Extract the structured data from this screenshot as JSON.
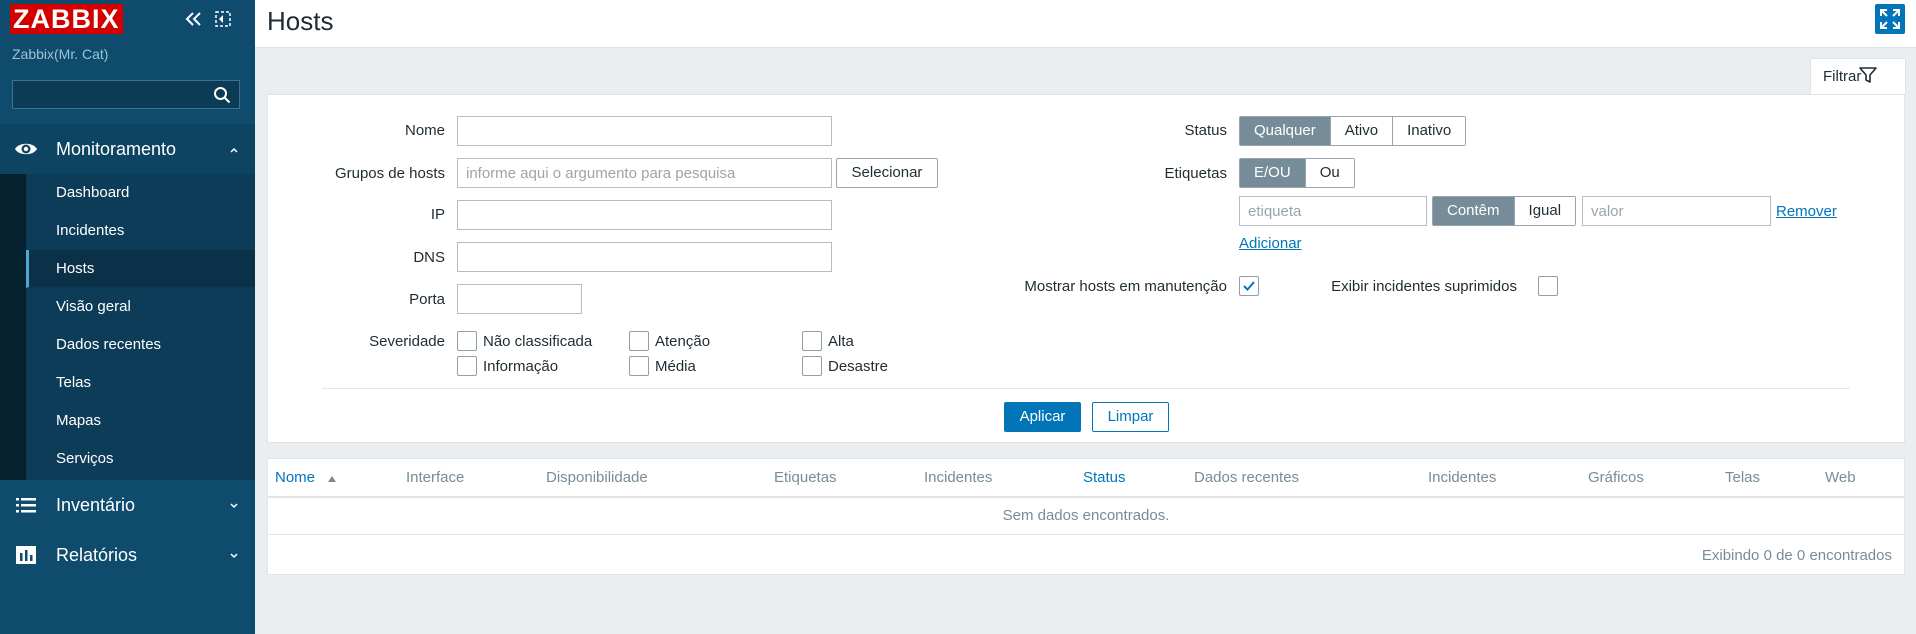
{
  "brand": {
    "logo": "ZABBIX",
    "server_name": "Zabbix(Mr. Cat)"
  },
  "sidebar": {
    "search_placeholder": "",
    "sections": [
      {
        "label": "Monitoramento",
        "icon": "eye-icon",
        "expanded": true
      },
      {
        "label": "Inventário",
        "icon": "list-icon",
        "expanded": false
      },
      {
        "label": "Relatórios",
        "icon": "bar-chart-icon",
        "expanded": false
      }
    ],
    "monitoring_items": [
      {
        "label": "Dashboard"
      },
      {
        "label": "Incidentes"
      },
      {
        "label": "Hosts",
        "active": true
      },
      {
        "label": "Visão geral"
      },
      {
        "label": "Dados recentes"
      },
      {
        "label": "Telas"
      },
      {
        "label": "Mapas"
      },
      {
        "label": "Serviços"
      }
    ]
  },
  "header": {
    "title": "Hosts"
  },
  "filter": {
    "tab_label": "Filtrar",
    "name_label": "Nome",
    "name_value": "",
    "host_groups_label": "Grupos de hosts",
    "host_groups_placeholder": "informe aqui o argumento para pesquisa",
    "select_button": "Selecionar",
    "ip_label": "IP",
    "ip_value": "",
    "dns_label": "DNS",
    "dns_value": "",
    "port_label": "Porta",
    "port_value": "",
    "severity_label": "Severidade",
    "severities": [
      {
        "label": "Não classificada",
        "checked": false
      },
      {
        "label": "Informação",
        "checked": false
      },
      {
        "label": "Atenção",
        "checked": false
      },
      {
        "label": "Média",
        "checked": false
      },
      {
        "label": "Alta",
        "checked": false
      },
      {
        "label": "Desastre",
        "checked": false
      }
    ],
    "status_label": "Status",
    "status_options": [
      "Qualquer",
      "Ativo",
      "Inativo"
    ],
    "status_selected": "Qualquer",
    "tags_label": "Etiquetas",
    "tags_mode_options": [
      "E/OU",
      "Ou"
    ],
    "tags_mode_selected": "E/OU",
    "tag_placeholder": "etiqueta",
    "tag_operator_options": [
      "Contêm",
      "Igual"
    ],
    "tag_operator_selected": "Contêm",
    "value_placeholder": "valor",
    "remove_link": "Remover",
    "add_link": "Adicionar",
    "maintenance_label": "Mostrar hosts em manutenção",
    "maintenance_checked": true,
    "suppressed_label": "Exibir incidentes suprimidos",
    "suppressed_checked": false,
    "apply_button": "Aplicar",
    "reset_button": "Limpar"
  },
  "table": {
    "columns": [
      "Nome",
      "Interface",
      "Disponibilidade",
      "Etiquetas",
      "Incidentes",
      "Status",
      "Dados recentes",
      "Incidentes",
      "Gráficos",
      "Telas",
      "Web"
    ],
    "sorted_column": "Nome",
    "sort_direction": "ascending",
    "no_data_text": "Sem dados encontrados.",
    "paging_text": "Exibindo 0 de 0 encontrados"
  },
  "colors": {
    "sidebar": "#0e4b6c",
    "accent": "#0275b8",
    "logo": "#d40000",
    "selected_segment": "#768d99"
  }
}
